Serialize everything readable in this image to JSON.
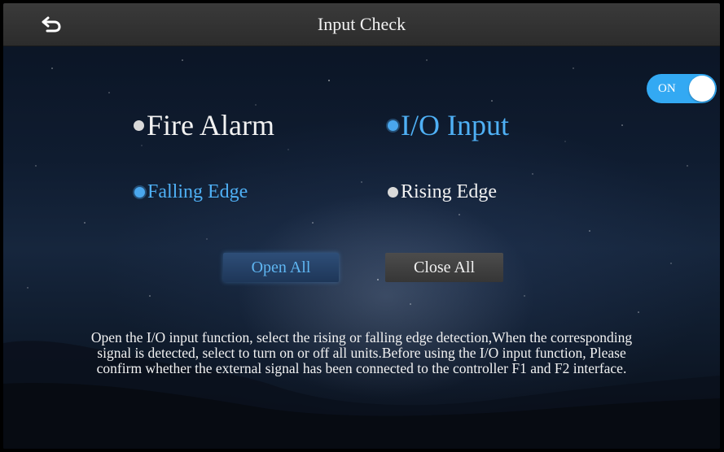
{
  "header": {
    "title": "Input Check"
  },
  "toggle": {
    "label": "ON",
    "state": "on"
  },
  "mode": {
    "fire_alarm": {
      "label": "Fire Alarm",
      "selected": false
    },
    "io_input": {
      "label": "I/O Input",
      "selected": true
    }
  },
  "edge": {
    "falling": {
      "label": "Falling Edge",
      "selected": true
    },
    "rising": {
      "label": "Rising Edge",
      "selected": false
    }
  },
  "buttons": {
    "open_all": "Open All",
    "close_all": "Close All"
  },
  "description": "Open the I/O input function, select the rising or falling edge detection,When the corresponding signal is detected, select to turn on or off all units.Before using the I/O input function, Please confirm whether the external signal has been connected to the controller F1 and F2 interface.",
  "colors": {
    "accent": "#33a9f3",
    "selected_text": "#4fb0f5",
    "topbar": "#333333"
  }
}
